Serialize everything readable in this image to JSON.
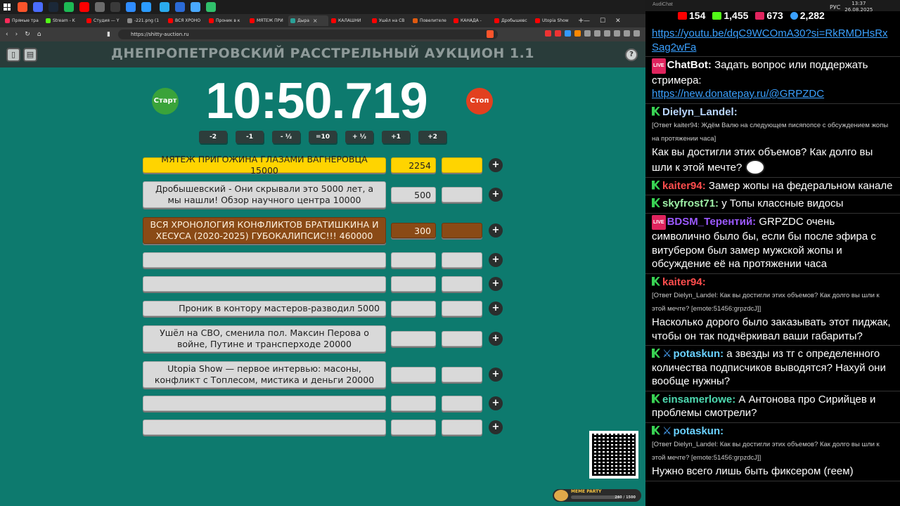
{
  "taskbar": {
    "apps": [
      {
        "name": "brave-icon",
        "color": "#fb542b"
      },
      {
        "name": "app-icon",
        "color": "#4a6cff"
      },
      {
        "name": "steam-icon",
        "color": "#1b2838"
      },
      {
        "name": "spotify-icon",
        "color": "#1db954"
      },
      {
        "name": "youtube-icon",
        "color": "#ff0000"
      },
      {
        "name": "app-icon",
        "color": "#6b6b6b"
      },
      {
        "name": "app-icon",
        "color": "#3a3a3a"
      },
      {
        "name": "app-icon",
        "color": "#2f8cff"
      },
      {
        "name": "app-icon",
        "color": "#2b9bff"
      },
      {
        "name": "telegram-icon",
        "color": "#2aabee"
      },
      {
        "name": "app-icon",
        "color": "#2b6ad6"
      },
      {
        "name": "app-icon",
        "color": "#49a9ff"
      },
      {
        "name": "app-icon",
        "color": "#30c06b"
      }
    ],
    "lang": "РУС",
    "time": "13:37",
    "date": "26.08.2025"
  },
  "browser": {
    "tabs": [
      {
        "label": "Прямые тра",
        "color": "#ff2b5a"
      },
      {
        "label": "Stream - K",
        "color": "#53fc18"
      },
      {
        "label": "Студия — Y",
        "color": "#ff0000"
      },
      {
        "label": "-221.png (1",
        "color": "#888888"
      },
      {
        "label": "ВСЯ ХРОНО",
        "color": "#ff0000"
      },
      {
        "label": "Проник в к",
        "color": "#ff0000"
      },
      {
        "label": "МЯТЕЖ ПРИ",
        "color": "#ff0000"
      },
      {
        "label": "Дыра",
        "color": "#2aa198",
        "active": true
      },
      {
        "label": "КАЛАШНИ",
        "color": "#ff0000"
      },
      {
        "label": "Ушёл на СВ",
        "color": "#ff0000"
      },
      {
        "label": "Повелителе",
        "color": "#e05a10"
      },
      {
        "label": "КАНАДА - ",
        "color": "#ff0000"
      },
      {
        "label": "Дробышевс",
        "color": "#ff0000"
      },
      {
        "label": "Utopia Show",
        "color": "#ff0000"
      }
    ],
    "url": "https://shitty-auction.ru"
  },
  "page": {
    "title": "ДНЕПРОПЕТРОВСКИЙ РАССТРЕЛЬНЫЙ АУКЦИОН 1.1",
    "timer": "10:50.719",
    "start_label": "Старт",
    "stop_label": "Стоп",
    "start_color": "#3aa33a",
    "stop_color": "#e2401f",
    "adjust": [
      "-2",
      "-1",
      "- ½",
      "=10",
      "+ ½",
      "+1",
      "+2"
    ],
    "lots": [
      {
        "title": "МЯТЕЖ ПРИГОЖИНА ГЛАЗАМИ ВАГНЕРОВЦА 15000",
        "amount": "2254",
        "style": "yellow"
      },
      {
        "title": "Дробышевский - Они скрывали это 5000 лет, а мы нашли! Обзор научного центра 10000",
        "amount": "500",
        "style": "gray"
      },
      {
        "title": "ВСЯ ХРОНОЛОГИЯ КОНФЛИКТОВ БРАТИШКИНА И ХЕСУСА (2020-2025) ГУБОКАЛИПСИС!!! 460000",
        "amount": "300",
        "style": "brown"
      },
      {
        "title": "",
        "amount": "",
        "style": "gray"
      },
      {
        "title": "",
        "amount": "",
        "style": "gray"
      },
      {
        "title": "Проник в контору мастеров-разводил 5000",
        "amount": "",
        "style": "gray"
      },
      {
        "title": "Ушёл на СВО, сменила пол. Максин Перова о войне, Путине и трансперходе 20000",
        "amount": "",
        "style": "gray"
      },
      {
        "title": "Utopia Show — первое интервью: масоны, конфликт с Топлесом, мистика и деньги 20000",
        "amount": "",
        "style": "gray"
      },
      {
        "title": "",
        "amount": "",
        "style": "gray"
      },
      {
        "title": "",
        "amount": "",
        "style": "gray"
      }
    ],
    "widget": {
      "label": "MEME PARTY",
      "count": "240 / 1500"
    }
  },
  "chat": {
    "header": "AudiChat",
    "stats": [
      {
        "icon": "youtube-icon",
        "value": "154",
        "color": "#ff0000"
      },
      {
        "icon": "kick-icon",
        "value": "1,455",
        "color": "#53fc18"
      },
      {
        "icon": "vk-live-icon",
        "value": "673",
        "color": "#e0245e"
      },
      {
        "icon": "viewers-icon",
        "value": "2,282",
        "color": "#3aa0ff"
      }
    ],
    "messages": [
      {
        "link": "https://youtu.be/dqC9WCOmA30?si=RkRMDHsRxSag2wFa"
      },
      {
        "badge": "live",
        "name": "ChatBot:",
        "name_color": "#ffffff",
        "text": "Задать вопрос или поддержать стримера:",
        "link": "https://new.donatepay.ru/@GRPZDC"
      },
      {
        "badge": "kick",
        "name": "Dielyn_Landel:",
        "name_color": "#b9d6ff",
        "reply": "[Ответ kaiter94: Ждём Валю на следующем писяпопсе с обсуждением жопы на протяжении часа]",
        "text": "Как вы достигли этих объемов? Как долго вы шли к этой мечте?",
        "emote": true
      },
      {
        "badge": "kick",
        "name": "kaiter94:",
        "name_color": "#ff4d4d",
        "text": "Замер жопы на федеральном канале"
      },
      {
        "badge": "kick",
        "name": "skyfrost71:",
        "name_color": "#9ef0a6",
        "text": "у Топы классные видосы"
      },
      {
        "badge": "live",
        "name": "BDSM_Терентий:",
        "name_color": "#9b59ff",
        "text": "GRPZDC очень символично было бы, если бы после эфира с витубером был замер мужской жопы и обсуждение её на протяжении часа"
      },
      {
        "badge": "kick",
        "name": "kaiter94:",
        "name_color": "#ff4d4d",
        "reply": "[Ответ Dielyn_Landel: Как вы достигли этих объемов? Как долго вы шли к этой мечте? [emote:51456:grpzdcJ]]",
        "text": "Насколько дорого было заказывать этот пиджак, чтобы он так подчёркивал ваши габариты?"
      },
      {
        "badge": "kick",
        "sword": true,
        "name": "potaskun:",
        "name_color": "#6ad1ff",
        "text": "а звезды из тг с определенного количества подписчиков выводятся? Нахуй они вообще нужны?"
      },
      {
        "badge": "kick",
        "name": "einsamerlowe:",
        "name_color": "#4dd9b0",
        "text": "А Антонова про Сирийцев и проблемы смотрели?"
      },
      {
        "badge": "kick",
        "sword": true,
        "name": "potaskun:",
        "name_color": "#6ad1ff",
        "reply": "[Ответ Dielyn_Landel: Как вы достигли этих объемов? Как долго вы шли к этой мечте? [emote:51456:grpzdcJ]]",
        "text": "Нужно всего лишь быть фиксером (геем)"
      }
    ]
  }
}
